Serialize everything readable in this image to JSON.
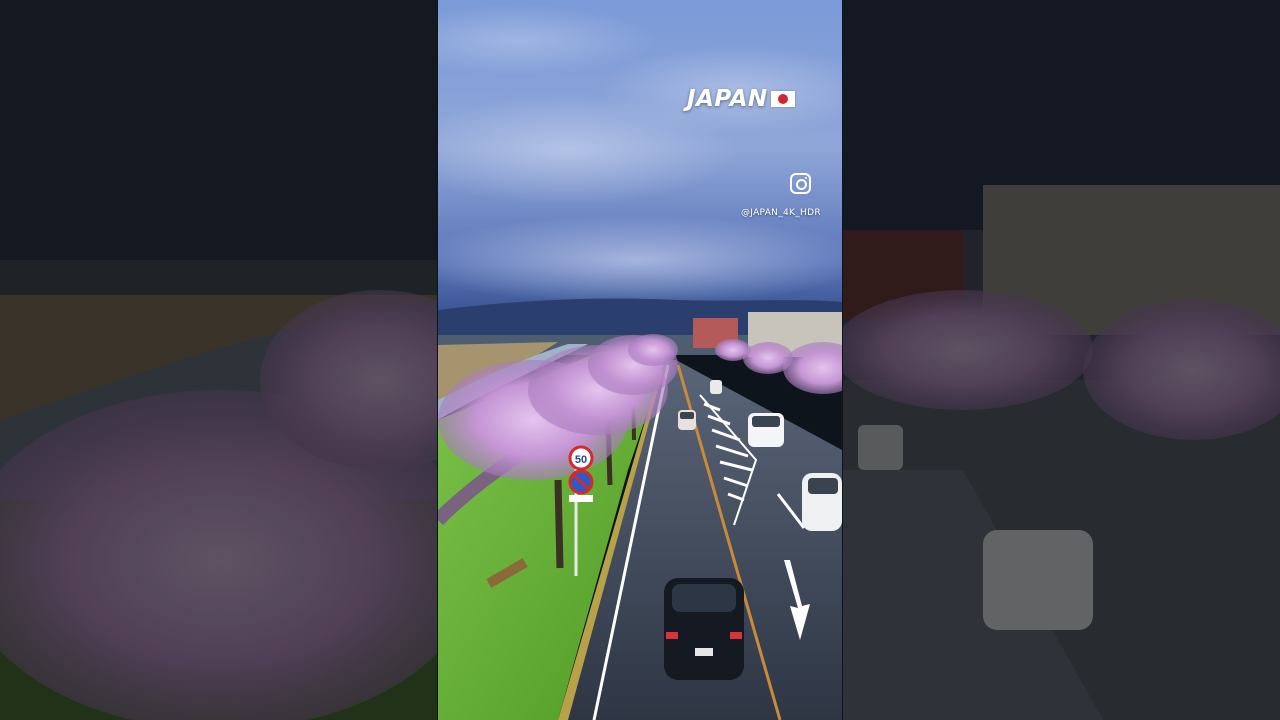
{
  "video": {
    "title": "JAPAN",
    "flag": "japan-flag",
    "social_icon": "instagram-icon",
    "handle": "@JAPAN_4K_HDR"
  },
  "colors": {
    "sky": "#6e86c8",
    "blossom": "#c99bd6",
    "grass": "#5fae2c",
    "road": "#3b4553",
    "flag_red": "#d6242f"
  }
}
